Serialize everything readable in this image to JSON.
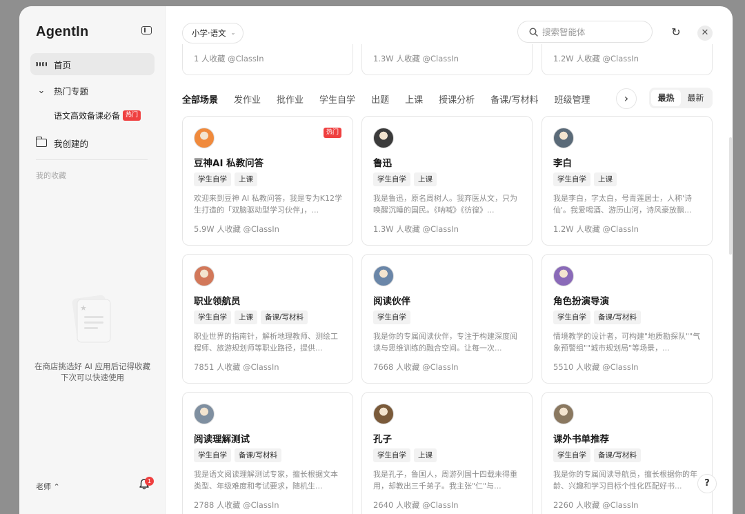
{
  "brand": "AgentIn",
  "sidebar": {
    "home": "首页",
    "hot_topics": "热门专题",
    "sub_item": "语文高效备课必备",
    "sub_badge": "热门",
    "my_created": "我创建的",
    "favorites_title": "我的收藏",
    "empty_line1": "在商店挑选好 AI 应用后记得收藏",
    "empty_line2": "下次可以快速使用",
    "role": "老师 ⌃",
    "notifications": "1"
  },
  "header": {
    "grade": "小学·语文",
    "search_placeholder": "搜索智能体"
  },
  "partial_cards": [
    {
      "meta": "1 人收藏   @ClassIn"
    },
    {
      "meta": "1.3W 人收藏   @ClassIn"
    },
    {
      "meta": "1.2W 人收藏   @ClassIn"
    }
  ],
  "tabs": [
    "全部场景",
    "发作业",
    "批作业",
    "学生自学",
    "出题",
    "上课",
    "授课分析",
    "备课/写材料",
    "班级管理"
  ],
  "sort": {
    "hot": "最热",
    "new": "最新"
  },
  "cards": [
    {
      "title": "豆神AI 私教问答",
      "badge": "热门",
      "tags": [
        "学生自学",
        "上课"
      ],
      "desc": "欢迎来到豆神 AI 私教问答，我是专为K12学生打造的「双脑驱动型学习伙伴」，...",
      "meta": "5.9W 人收藏   @ClassIn",
      "avatar_color": "#f08a3c"
    },
    {
      "title": "鲁迅",
      "tags": [
        "学生自学",
        "上课"
      ],
      "desc": "我是鲁迅，原名周树人。我弃医从文，只为唤醒沉睡的国民。《呐喊》《彷徨》...",
      "meta": "1.3W 人收藏   @ClassIn",
      "avatar_color": "#3b3b3b"
    },
    {
      "title": "李白",
      "tags": [
        "学生自学",
        "上课"
      ],
      "desc": "我是李白，字太白，号青莲居士，人称'诗仙'。我爱喝酒、游历山河，诗风豪放飘...",
      "meta": "1.2W 人收藏   @ClassIn",
      "avatar_color": "#5a6a78"
    },
    {
      "title": "职业领航员",
      "tags": [
        "学生自学",
        "上课",
        "备课/写材料"
      ],
      "desc": "职业世界的指南针，解析地理教师、测绘工程师、旅游规划师等职业路径，提供...",
      "meta": "7851 人收藏   @ClassIn",
      "avatar_color": "#d2785a"
    },
    {
      "title": "阅读伙伴",
      "tags": [
        "学生自学"
      ],
      "desc": "我是你的专属阅读伙伴，专注于构建深度阅读与思维训练的融合空间。让每一次...",
      "meta": "7668 人收藏   @ClassIn",
      "avatar_color": "#6a86a8"
    },
    {
      "title": "角色扮演导演",
      "tags": [
        "学生自学",
        "备课/写材料"
      ],
      "desc": "情境教学的设计者，可构建\"地质勘探队\"\"气象预警组\"\"城市规划局\"等场景，...",
      "meta": "5510 人收藏   @ClassIn",
      "avatar_color": "#8a6ab8"
    },
    {
      "title": "阅读理解测试",
      "tags": [
        "学生自学",
        "备课/写材料"
      ],
      "desc": "我是语文阅读理解测试专家，擅长根据文本类型、年级难度和考试要求，随机生...",
      "meta": "2788 人收藏   @ClassIn",
      "avatar_color": "#7f8fa0"
    },
    {
      "title": "孔子",
      "tags": [
        "学生自学",
        "上课"
      ],
      "desc": "我是孔子，鲁国人，周游列国十四载未得重用，却教出三千弟子。我主张\"仁\"与...",
      "meta": "2640 人收藏   @ClassIn",
      "avatar_color": "#7a5a3a"
    },
    {
      "title": "课外书单推荐",
      "tags": [
        "学生自学",
        "备课/写材料"
      ],
      "desc": "我是你的专属阅读导航员，擅长根据你的年龄、兴趣和学习目标个性化匹配好书...",
      "meta": "2260 人收藏   @ClassIn",
      "avatar_color": "#8a7860"
    }
  ],
  "colors": {
    "accent_red": "#ef4040",
    "sidebar_bg": "#f6f6f6"
  }
}
